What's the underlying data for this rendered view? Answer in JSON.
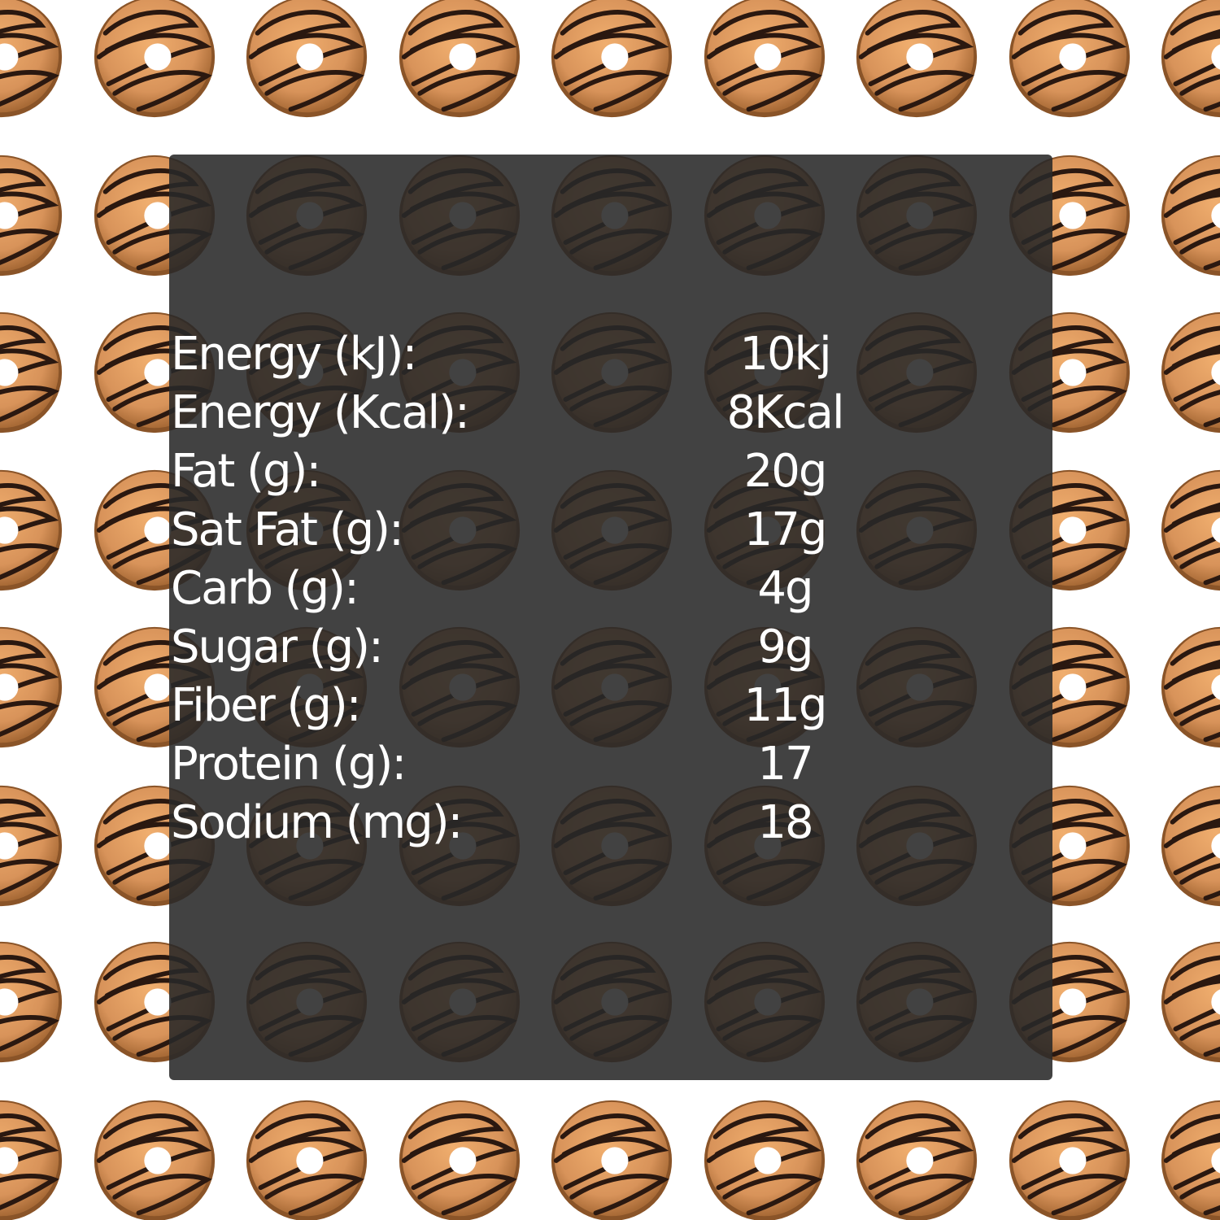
{
  "colors": {
    "page_background": "#ffffff",
    "panel_overlay": "#282828",
    "text": "#ffffff",
    "donut_dough": "#c98a4e",
    "donut_glaze": "#e6a062",
    "donut_drizzle": "#2a1810"
  },
  "background_icon": "glazed-donut-icon",
  "nutrition": [
    {
      "label": "Energy (kJ):",
      "value": "10kj"
    },
    {
      "label": "Energy (Kcal):",
      "value": "8Kcal"
    },
    {
      "label": "Fat (g):",
      "value": "20g"
    },
    {
      "label": "Sat Fat (g):",
      "value": "17g"
    },
    {
      "label": "Carb (g):",
      "value": "4g"
    },
    {
      "label": "Sugar (g):",
      "value": "9g"
    },
    {
      "label": "Fiber (g):",
      "value": "11g"
    },
    {
      "label": "Protein (g):",
      "value": "17"
    },
    {
      "label": "Sodium (mg):",
      "value": "18"
    }
  ]
}
